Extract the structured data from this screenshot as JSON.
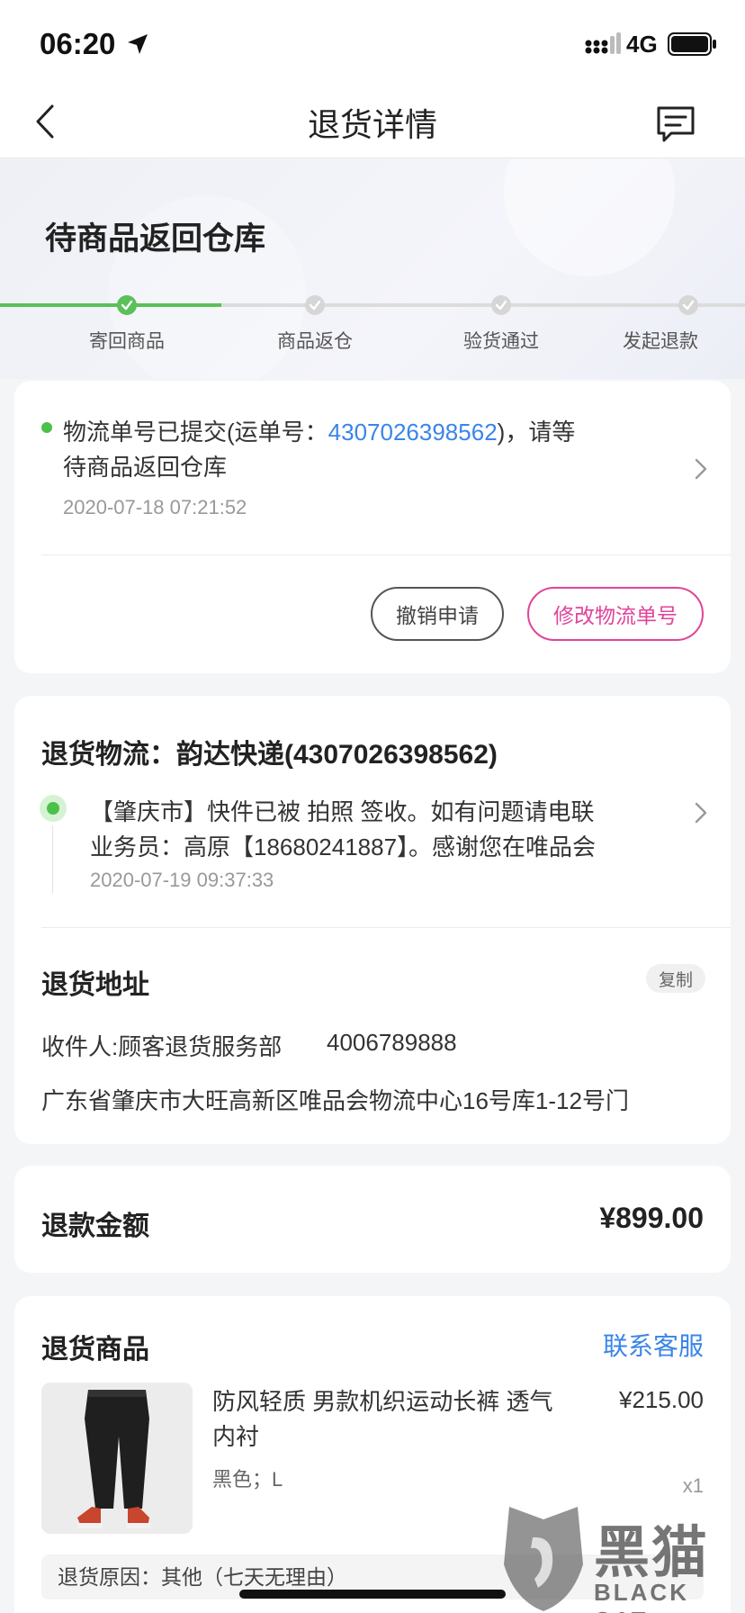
{
  "status": {
    "time": "06:20",
    "network": "4G"
  },
  "nav": {
    "title": "退货详情"
  },
  "header": {
    "title": "待商品返回仓库",
    "steps": [
      "寄回商品",
      "商品返仓",
      "验货通过",
      "发起退款"
    ],
    "current_step": 1
  },
  "logistics_notice": {
    "text_before": "物流单号已提交(运单号：",
    "tracking_no": "4307026398562",
    "text_after": ")，请等",
    "text_line2": "待商品返回仓库",
    "time": "2020-07-18 07:21:52",
    "cancel_label": "撤销申请",
    "modify_label": "修改物流单号"
  },
  "return_logistics": {
    "title": "退货物流：韵达快递(4307026398562)",
    "event_line1": "【肇庆市】快件已被 拍照 签收。如有问题请电联",
    "event_line2": "业务员：高原【18680241887】。感谢您在唯品会",
    "event_time": "2020-07-19 09:37:33"
  },
  "return_address": {
    "title": "退货地址",
    "copy_label": "复制",
    "recipient": "收件人:顾客退货服务部",
    "phone": "4006789888",
    "address": "广东省肇庆市大旺高新区唯品会物流中心16号库1-12号门"
  },
  "refund": {
    "label": "退款金额",
    "amount": "¥899.00"
  },
  "return_goods": {
    "title": "退货商品",
    "contact_label": "联系客服",
    "product_name_line1": "防风轻质 男款机织运动长裤 透气",
    "product_name_line2": "内衬",
    "spec": "黑色；L",
    "price": "¥215.00",
    "quantity": "x1",
    "reason": "退货原因：其他（七天无理由）"
  },
  "watermark": {
    "cn": "黑猫",
    "en": "BLACK CAT"
  },
  "colors": {
    "accent_green": "#5ac05a",
    "link_blue": "#3a85e8",
    "pink": "#e1449a"
  }
}
